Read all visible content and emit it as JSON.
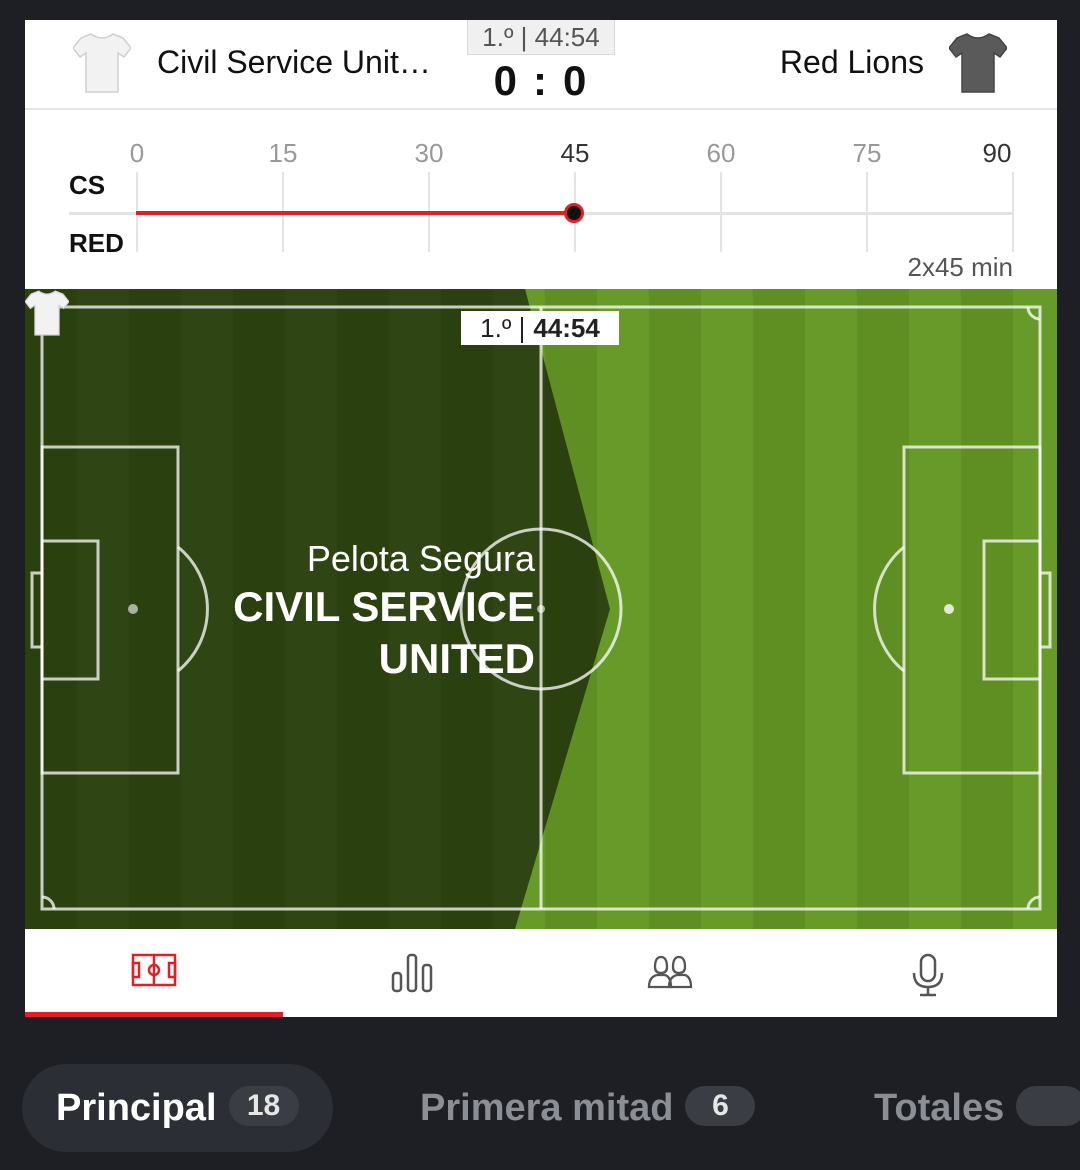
{
  "match": {
    "home_name": "Civil Service Unit…",
    "away_name": "Red Lions",
    "clock": "1.º | 44:54",
    "home_score": "0",
    "score_separator": ":",
    "away_score": "0",
    "home_shirt_color": "#f2f2f2",
    "away_shirt_color": "#5a5a5a"
  },
  "timeline": {
    "ticks": [
      "0",
      "15",
      "30",
      "45",
      "60",
      "75",
      "90"
    ],
    "home_code": "CS",
    "away_code": "RED",
    "current_minute": 44.9,
    "duration": "2x45 min",
    "accent": "#e01f26"
  },
  "pitch": {
    "period": "1.º",
    "time": "44:54",
    "state_label": "Pelota Segura",
    "team_line1": "CIVIL SERVICE",
    "team_line2": "UNITED"
  },
  "tabs": [
    {
      "icon": "pitch-icon",
      "active": true
    },
    {
      "icon": "stats-icon",
      "active": false
    },
    {
      "icon": "lineups-icon",
      "active": false
    },
    {
      "icon": "commentary-icon",
      "active": false
    }
  ],
  "markets": [
    {
      "label": "Principal",
      "count": "18"
    },
    {
      "label": "Primera mitad",
      "count": "6"
    },
    {
      "label": "Totales",
      "count": ""
    }
  ]
}
